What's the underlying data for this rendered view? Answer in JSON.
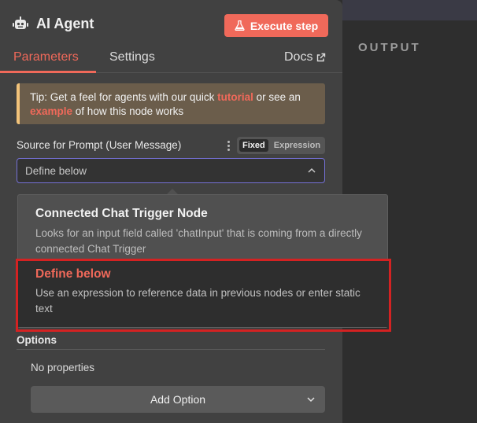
{
  "header": {
    "title": "AI Agent",
    "execute_label": "Execute step"
  },
  "tabs": [
    {
      "label": "Parameters",
      "active": true
    },
    {
      "label": "Settings",
      "active": false
    }
  ],
  "docs_label": "Docs",
  "output_label": "OUTPUT",
  "tip": {
    "prefix": "Tip: Get a feel for agents with our quick ",
    "link1": "tutorial",
    "middle": " or see an ",
    "link2": "example",
    "suffix": " of how this node works"
  },
  "prompt_source": {
    "label": "Source for Prompt (User Message)",
    "mode_fixed": "Fixed",
    "mode_expression": "Expression",
    "value": "Define below"
  },
  "dropdown": {
    "options": [
      {
        "title": "Connected Chat Trigger Node",
        "description": "Looks for an input field called 'chatInput' that is coming from a directly connected Chat Trigger"
      },
      {
        "title": "Define below",
        "description": "Use an expression to reference data in previous nodes or enter static text"
      }
    ]
  },
  "options_section": {
    "label": "Options",
    "empty_text": "No properties",
    "add_label": "Add Option"
  },
  "colors": {
    "accent": "#f0695a",
    "panel": "#414141",
    "highlight": "#d42222",
    "focus_border": "#7571d6",
    "tip_border": "#f2c37a"
  },
  "icons": [
    "robot-icon",
    "flask-icon",
    "external-link-icon",
    "kebab-menu-icon",
    "chevron-up-icon",
    "chevron-down-icon"
  ]
}
